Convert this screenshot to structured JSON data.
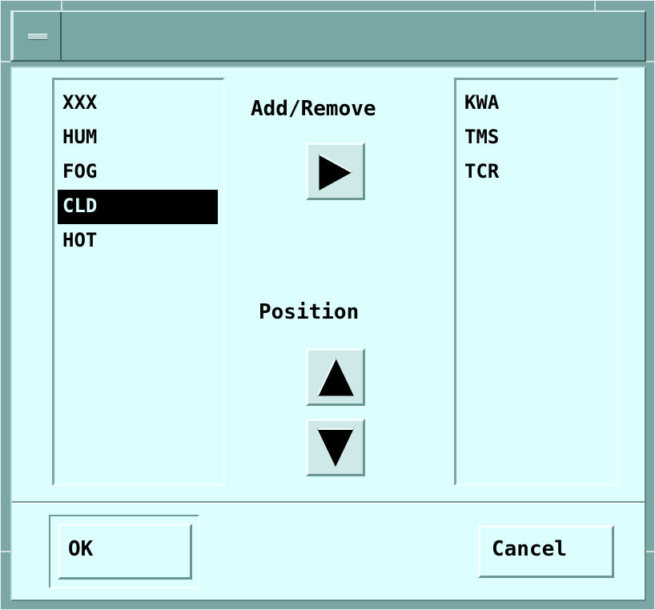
{
  "window": {
    "menu_button_icon": "window-menu-icon"
  },
  "available_list": {
    "items": [
      "XXX",
      "HUM",
      "FOG",
      "CLD",
      "HOT"
    ],
    "selected": "CLD"
  },
  "selected_list": {
    "items": [
      "KWA",
      "TMS",
      "TCR"
    ]
  },
  "controls": {
    "add_remove_label": "Add/Remove",
    "add_remove_icon": "triangle-right-icon",
    "position_label": "Position",
    "move_up_icon": "triangle-up-icon",
    "move_down_icon": "triangle-down-icon"
  },
  "buttons": {
    "ok_label": "OK",
    "cancel_label": "Cancel"
  },
  "colors": {
    "client_bg": "#dcfefe",
    "titlebar_bg": "#77a8a6",
    "selection_bg": "#000000"
  }
}
